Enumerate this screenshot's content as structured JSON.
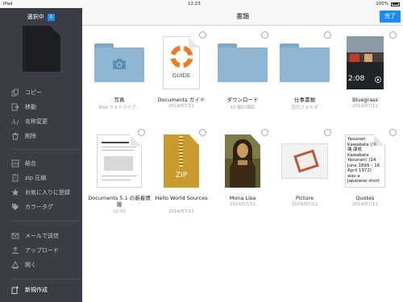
{
  "status_bar": {
    "device": "iPad",
    "time": "12:23",
    "battery": "100%"
  },
  "sidebar": {
    "header": "選択中",
    "count": "0",
    "items": [
      {
        "icon": "copy-icon",
        "label": "コピー"
      },
      {
        "icon": "move-icon",
        "label": "移動"
      },
      {
        "icon": "rename-icon",
        "label": "名称変更"
      },
      {
        "icon": "trash-icon",
        "label": "削除"
      },
      {
        "icon": "merge-icon",
        "label": "結合"
      },
      {
        "icon": "zip-icon",
        "label": "zip 圧縮"
      },
      {
        "icon": "star-icon",
        "label": "お気に入りに登録"
      },
      {
        "icon": "tag-icon",
        "label": "カラータグ"
      },
      {
        "icon": "mail-icon",
        "label": "メールで送信"
      },
      {
        "icon": "upload-icon",
        "label": "アップロード"
      },
      {
        "icon": "open-in-icon",
        "label": "開く"
      }
    ],
    "new_label": "新規作成"
  },
  "toolbar": {
    "title": "書類",
    "done_label": "完了"
  },
  "files": [
    {
      "name": "写真",
      "sub": "iPad フォトライブ..."
    },
    {
      "name": "Documents ガイド",
      "sub": "2014/07/11",
      "badge": "GUIDE"
    },
    {
      "name": "ダウンロード",
      "sub": "10 個の項目"
    },
    {
      "name": "仕事書類",
      "sub": "空のフォルダ"
    },
    {
      "name": "Bluegrass",
      "sub": "2014/07/11",
      "duration": "2:08"
    },
    {
      "name": "Documents 5.1 の新着情報",
      "sub": "12:01"
    },
    {
      "name": "Hello World Sources",
      "sub": "2014/07/11",
      "badge": "ZIP"
    },
    {
      "name": "Mona Lisa",
      "sub": "2014/07/11"
    },
    {
      "name": "Picture",
      "sub": "2014/07/11"
    },
    {
      "name": "Quotes",
      "sub": "2014/07/11",
      "preview": "Yasunari Kawabata (川端 康成 Kawabata Yasunari) (14 June 1899 – 16 April 1972) was a Japanese short"
    }
  ]
}
